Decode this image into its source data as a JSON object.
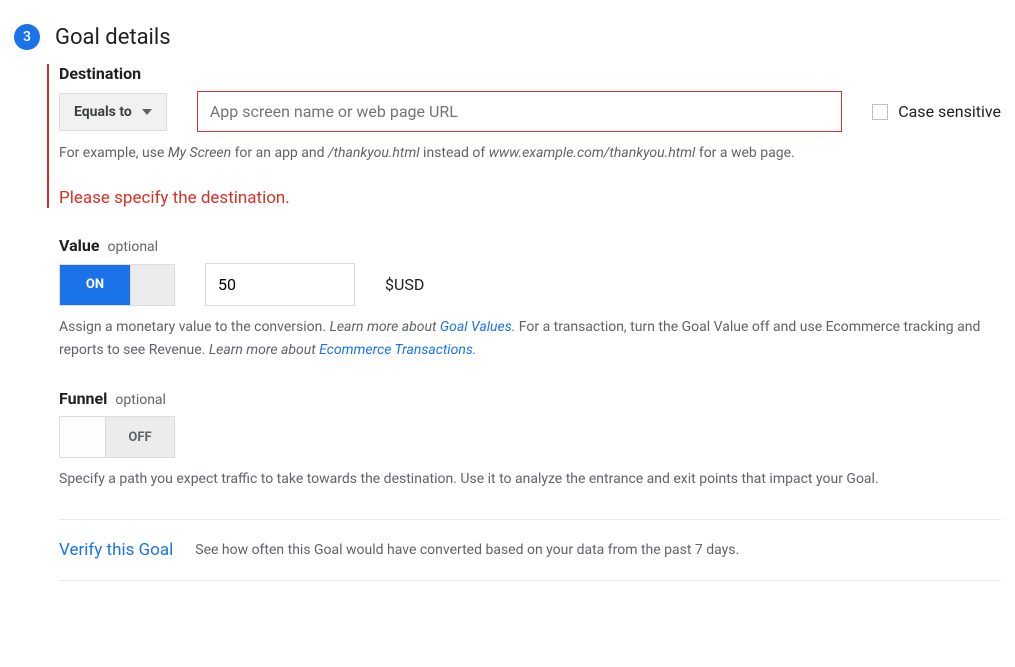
{
  "step": {
    "number": "3",
    "title": "Goal details"
  },
  "destination": {
    "title": "Destination",
    "match_type": "Equals to",
    "input_placeholder": "App screen name or web page URL",
    "case_sensitive_label": "Case sensitive",
    "helper_prefix": "For example, use ",
    "helper_em1": "My Screen",
    "helper_mid1": " for an app and ",
    "helper_em2": "/thankyou.html",
    "helper_mid2": " instead of ",
    "helper_em3": "www.example.com/thankyou.html",
    "helper_suffix": " for a web page.",
    "error": "Please specify the destination."
  },
  "value": {
    "title": "Value",
    "optional": "optional",
    "toggle_on": "ON",
    "amount": "50",
    "currency": "$USD",
    "helper_pre": "Assign a monetary value to the conversion. ",
    "helper_learn_label_em": "Learn more about ",
    "link_goal_values": "Goal Values.",
    "helper_mid": " For a transaction, turn the Goal Value off and use Ecommerce tracking and reports to see Revenue. ",
    "helper_learn_label_em2": "Learn more about ",
    "link_ecommerce": "Ecommerce Transactions."
  },
  "funnel": {
    "title": "Funnel",
    "optional": "optional",
    "toggle_off": "OFF",
    "helper": "Specify a path you expect traffic to take towards the destination. Use it to analyze the entrance and exit points that impact your Goal."
  },
  "verify": {
    "link": "Verify this Goal",
    "desc": "See how often this Goal would have converted based on your data from the past 7 days."
  }
}
